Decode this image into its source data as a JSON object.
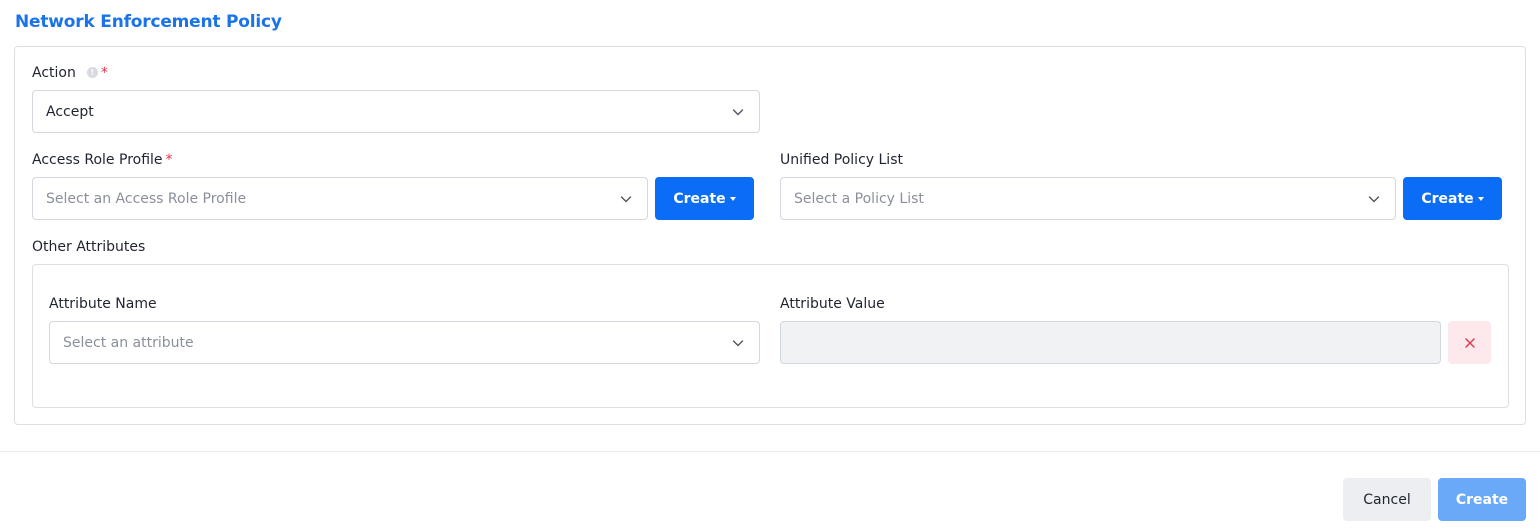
{
  "page": {
    "title": "Network Enforcement Policy"
  },
  "action": {
    "label": "Action",
    "info_icon": "info-icon",
    "required_mark": "*",
    "value": "Accept"
  },
  "access_role_profile": {
    "label": "Access Role Profile",
    "required_mark": "*",
    "placeholder": "Select an Access Role Profile",
    "create_label": "Create"
  },
  "unified_policy_list": {
    "label": "Unified Policy List",
    "placeholder": "Select a Policy List",
    "create_label": "Create"
  },
  "other_attributes": {
    "label": "Other Attributes",
    "attribute_name_label": "Attribute Name",
    "attribute_name_placeholder": "Select an attribute",
    "attribute_value_label": "Attribute Value",
    "attribute_value": "",
    "remove_icon": "close-icon"
  },
  "footer": {
    "cancel_label": "Cancel",
    "create_label": "Create"
  },
  "colors": {
    "accent": "#0b6cf6",
    "title": "#1a73e8",
    "required": "#e5334b",
    "create_disabled": "#6aa9f8",
    "delete_bg": "#fde8ec"
  }
}
